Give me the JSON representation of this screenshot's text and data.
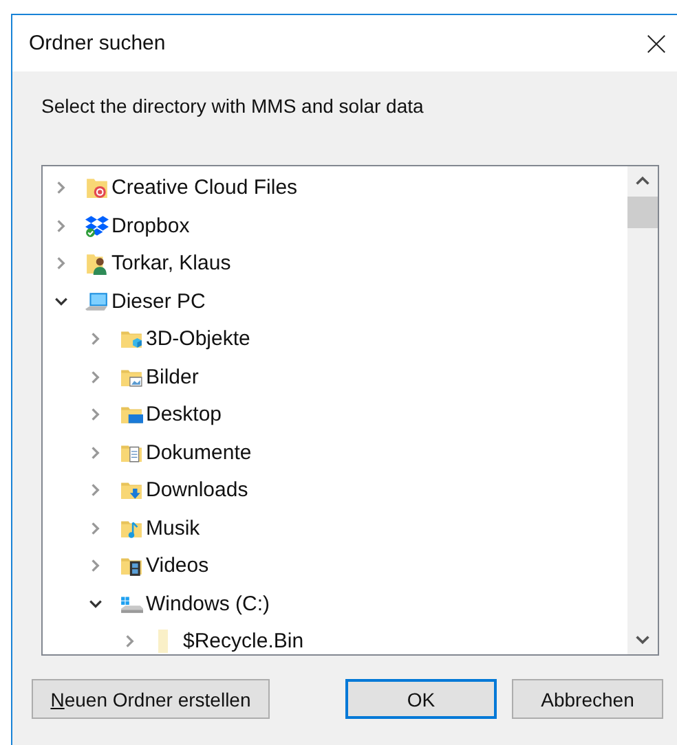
{
  "window": {
    "title": "Ordner suchen"
  },
  "prompt": "Select the directory with MMS and solar data",
  "tree": {
    "items": [
      {
        "label": "Creative Cloud Files",
        "kind": "creative-cloud",
        "expanded": false
      },
      {
        "label": "Dropbox",
        "kind": "dropbox",
        "expanded": false
      },
      {
        "label": "Torkar, Klaus",
        "kind": "user",
        "expanded": false
      },
      {
        "label": "Dieser PC",
        "kind": "pc",
        "expanded": true,
        "children": [
          {
            "label": "3D-Objekte",
            "kind": "objects-3d",
            "expanded": false
          },
          {
            "label": "Bilder",
            "kind": "pictures",
            "expanded": false
          },
          {
            "label": "Desktop",
            "kind": "desktop",
            "expanded": false
          },
          {
            "label": "Dokumente",
            "kind": "documents",
            "expanded": false
          },
          {
            "label": "Downloads",
            "kind": "downloads",
            "expanded": false
          },
          {
            "label": "Musik",
            "kind": "music",
            "expanded": false
          },
          {
            "label": "Videos",
            "kind": "videos",
            "expanded": false
          },
          {
            "label": "Windows (C:)",
            "kind": "drive",
            "expanded": true,
            "children": [
              {
                "label": "$Recycle.Bin",
                "kind": "hidden-folder",
                "expanded": false
              }
            ]
          }
        ]
      }
    ]
  },
  "buttons": [
    {
      "label": "Neuen Ordner erstellen",
      "underline_first": true,
      "default": false
    },
    {
      "label": "OK",
      "underline_first": false,
      "default": true
    },
    {
      "label": "Abbrechen",
      "underline_first": false,
      "default": false
    }
  ]
}
